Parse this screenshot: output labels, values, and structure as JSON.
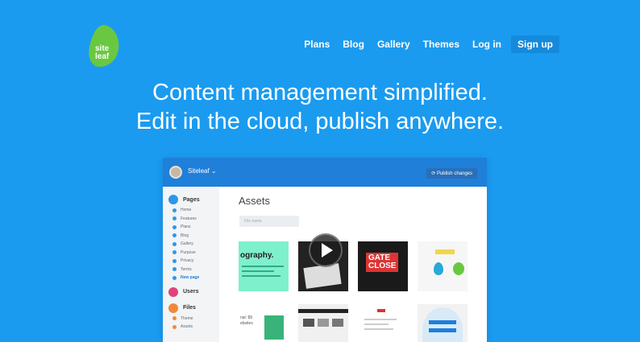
{
  "brand": {
    "logo_line1": "site",
    "logo_line2": "leaf",
    "logo_color": "#6ac840"
  },
  "nav": {
    "plans": "Plans",
    "blog": "Blog",
    "gallery": "Gallery",
    "themes": "Themes",
    "login": "Log in",
    "signup": "Sign up"
  },
  "hero": {
    "line1": "Content management simplified.",
    "line2": "Edit in the cloud, publish anywhere."
  },
  "app": {
    "site_name": "Siteleaf",
    "publish_button": "Publish changes",
    "sidebar": {
      "pages_label": "Pages",
      "page_items": [
        "Home",
        "Features",
        "Plans",
        "Blog",
        "Gallery",
        "Purpose",
        "Privacy",
        "Terms",
        "New page"
      ],
      "users_label": "Users",
      "files_label": "Files",
      "file_items": [
        "Theme",
        "Assets"
      ]
    },
    "main_title": "Assets",
    "filter_placeholder": "File name",
    "thumb_texts": {
      "t1": "ography.",
      "t3_line1": "GATE",
      "t3_line2": "CLOSE",
      "t5_line1": "nal: $9",
      "t5_line2": "ebsites"
    }
  },
  "colors": {
    "background": "#1a9bf0",
    "app_header": "#1f7fd9"
  }
}
